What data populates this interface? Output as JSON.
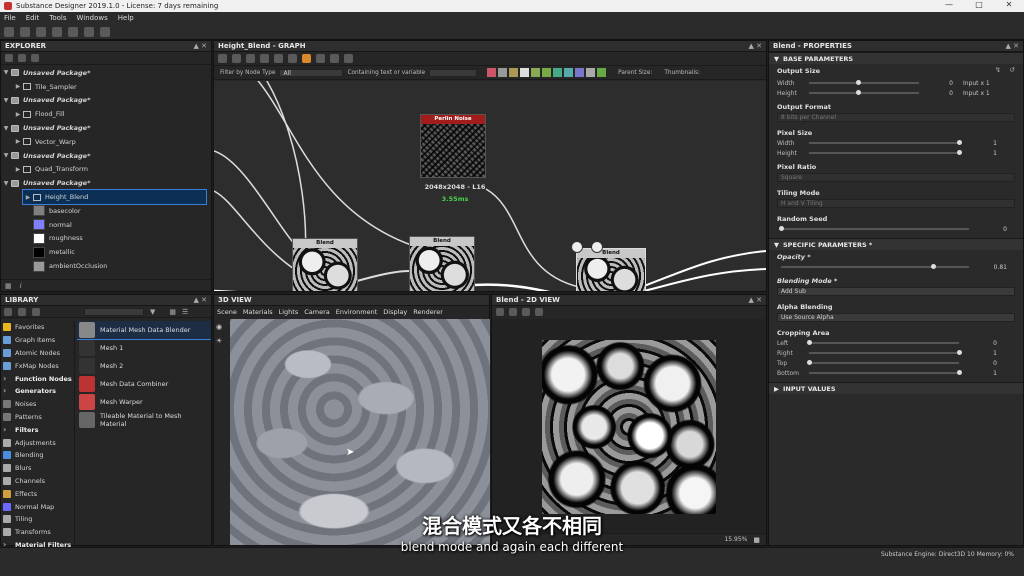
{
  "window": {
    "title": "Substance Designer 2019.1.0 - License: 7 days remaining"
  },
  "menu": [
    "File",
    "Edit",
    "Tools",
    "Windows",
    "Help"
  ],
  "explorer": {
    "title": "EXPLORER",
    "items": [
      {
        "label": "Unsaved Package*",
        "kind": "pkg"
      },
      {
        "label": "Tile_Sampler",
        "kind": "graph"
      },
      {
        "label": "Unsaved Package*",
        "kind": "pkg"
      },
      {
        "label": "Flood_Fill",
        "kind": "graph"
      },
      {
        "label": "Unsaved Package*",
        "kind": "pkg"
      },
      {
        "label": "Vector_Warp",
        "kind": "graph"
      },
      {
        "label": "Unsaved Package*",
        "kind": "pkg"
      },
      {
        "label": "Quad_Transform",
        "kind": "graph"
      },
      {
        "label": "Unsaved Package*",
        "kind": "pkg"
      },
      {
        "label": "Height_Blend",
        "kind": "graph-selected"
      }
    ],
    "outputs": [
      {
        "label": "basecolor",
        "color": "#808080"
      },
      {
        "label": "normal",
        "color": "#8080ff"
      },
      {
        "label": "roughness",
        "color": "#ffffff"
      },
      {
        "label": "metallic",
        "color": "#000000"
      },
      {
        "label": "ambientOcclusion",
        "color": "#9a9a9a"
      }
    ]
  },
  "graph": {
    "title": "Height_Blend - GRAPH",
    "filter_label": "Filter by Node Type",
    "filter_value": "All",
    "containing_label": "Containing text or variable",
    "parent_size_label": "Parent Size:",
    "thumbnails_label": "Thumbnails:",
    "perlin": {
      "title": "Perlin Noise",
      "size": "2048x2048 - L16",
      "time": "3.55ms"
    },
    "blend_label": "Blend"
  },
  "library": {
    "title": "LIBRARY",
    "search_placeholder": "",
    "categories": [
      {
        "label": "Favorites",
        "color": "#e8b422",
        "hdr": false
      },
      {
        "label": "Graph Items",
        "color": "#6a9cd8",
        "hdr": false
      },
      {
        "label": "Atomic Nodes",
        "color": "#6a9cd8",
        "hdr": false
      },
      {
        "label": "FxMap Nodes",
        "color": "#6a9cd8",
        "hdr": false
      },
      {
        "label": "Function Nodes",
        "color": "#ffffff",
        "hdr": true
      },
      {
        "label": "Generators",
        "color": "#ffffff",
        "hdr": true
      },
      {
        "label": "Noises",
        "color": "#777777",
        "hdr": false
      },
      {
        "label": "Patterns",
        "color": "#777777",
        "hdr": false
      },
      {
        "label": "Filters",
        "color": "#ffffff",
        "hdr": true
      },
      {
        "label": "Adjustments",
        "color": "#aaaaaa",
        "hdr": false
      },
      {
        "label": "Blending",
        "color": "#4a8de0",
        "hdr": false
      },
      {
        "label": "Blurs",
        "color": "#aaaaaa",
        "hdr": false
      },
      {
        "label": "Channels",
        "color": "#aaaaaa",
        "hdr": false
      },
      {
        "label": "Effects",
        "color": "#d0a040",
        "hdr": false
      },
      {
        "label": "Normal Map",
        "color": "#6a6aff",
        "hdr": false
      },
      {
        "label": "Tiling",
        "color": "#aaaaaa",
        "hdr": false
      },
      {
        "label": "Transforms",
        "color": "#aaaaaa",
        "hdr": false
      },
      {
        "label": "Material Filters",
        "color": "#ffffff",
        "hdr": true
      }
    ],
    "results": [
      {
        "label": "Material Mesh Data Blender",
        "selected": true
      },
      {
        "label": "Mesh 1",
        "selected": false
      },
      {
        "label": "Mesh 2",
        "selected": false
      },
      {
        "label": "Mesh Data Combiner",
        "selected": false
      },
      {
        "label": "Mesh Warper",
        "selected": false
      },
      {
        "label": "Tileable Material to Mesh Material",
        "selected": false
      }
    ]
  },
  "view3d": {
    "title": "3D VIEW",
    "menu": [
      "Scene",
      "Materials",
      "Lights",
      "Camera",
      "Environment",
      "Display",
      "Renderer"
    ]
  },
  "view2d": {
    "title": "Blend - 2D VIEW",
    "zoom": "15.95%"
  },
  "properties": {
    "title": "Blend - PROPERTIES",
    "base_title": "BASE PARAMETERS",
    "output_size": {
      "label": "Output Size",
      "width_label": "Width",
      "height_label": "Height",
      "width_val": "0",
      "height_val": "0",
      "width_input": "Input x 1",
      "height_input": "Input x 1",
      "width_frac": 0.45,
      "height_frac": 0.45
    },
    "output_format": {
      "label": "Output Format",
      "value": "8 bits per Channel"
    },
    "pixel_size": {
      "label": "Pixel Size",
      "width_label": "Width",
      "height_label": "Height",
      "width_val": "1",
      "height_val": "1",
      "width_frac": 1.0,
      "height_frac": 1.0
    },
    "pixel_ratio": {
      "label": "Pixel Ratio",
      "value": "Square"
    },
    "tiling_mode": {
      "label": "Tiling Mode",
      "value": "H and V Tiling"
    },
    "random_seed": {
      "label": "Random Seed",
      "value": "0",
      "frac": 0.0
    },
    "specific_title": "SPECIFIC PARAMETERS *",
    "opacity": {
      "label": "Opacity *",
      "value": "0.81",
      "frac": 0.81
    },
    "blending_mode": {
      "label": "Blending Mode *",
      "value": "Add Sub"
    },
    "alpha_blending": {
      "label": "Alpha Blending",
      "value": "Use Source Alpha"
    },
    "cropping": {
      "label": "Cropping Area",
      "rows": [
        {
          "label": "Left",
          "value": "0",
          "frac": 0.0
        },
        {
          "label": "Right",
          "value": "1",
          "frac": 1.0
        },
        {
          "label": "Top",
          "value": "0",
          "frac": 0.0
        },
        {
          "label": "Bottom",
          "value": "1",
          "frac": 1.0
        }
      ]
    },
    "input_values_title": "INPUT VALUES"
  },
  "status": {
    "engine": "Substance Engine: Direct3D 10   Memory: 0%"
  },
  "subtitles": {
    "cn": "混合模式又各不相同",
    "en": "blend mode and again each different"
  }
}
